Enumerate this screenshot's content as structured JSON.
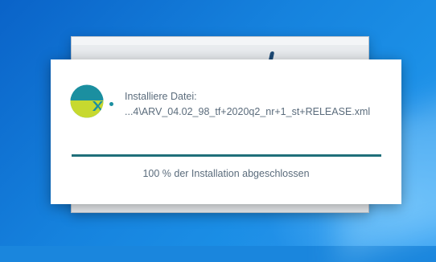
{
  "installer": {
    "caption": "Installiere Datei:",
    "file_path": "...4\\ARV_04.02_98_tf+2020q2_nr+1_st+RELEASE.xml",
    "progress_percent": 100,
    "status_text": "100 % der Installation abgeschlossen",
    "logo_icon": "installer-app-logo-icon"
  },
  "colors": {
    "desktop_accent": "#1683de",
    "logo_teal": "#1b8fa0",
    "logo_lime": "#c7d92f",
    "progress_fill": "#1f6f7a",
    "text": "#5b6c7c"
  }
}
